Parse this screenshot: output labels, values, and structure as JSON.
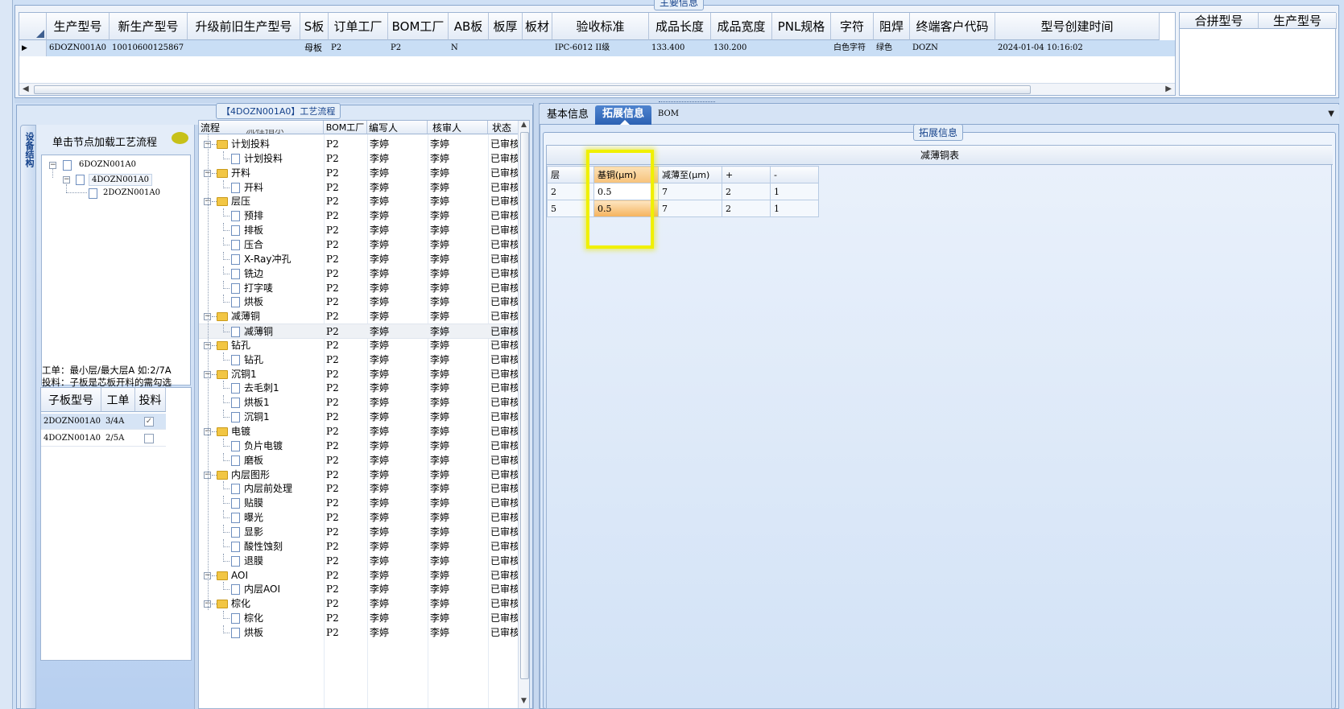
{
  "top_group_title": "主要信息",
  "main_grid": {
    "columns": [
      {
        "label": "生产型号"
      },
      {
        "label": "新生产型号"
      },
      {
        "label": "升级前旧生产型号"
      },
      {
        "label": "S板"
      },
      {
        "label": "订单工厂"
      },
      {
        "label": "BOM工厂"
      },
      {
        "label": "AB板"
      },
      {
        "label": "板厚"
      },
      {
        "label": "板材"
      },
      {
        "label": "验收标准"
      },
      {
        "label": "成品长度"
      },
      {
        "label": "成品宽度"
      },
      {
        "label": "PNL规格"
      },
      {
        "label": "字符"
      },
      {
        "label": "阻焊"
      },
      {
        "label": "终端客户代码"
      },
      {
        "label": "型号创建时间"
      }
    ],
    "row": [
      "6DOZN001A0",
      "10010600125867",
      "",
      "母板",
      "P2",
      "P2",
      "N",
      "",
      "",
      "IPC-6012 II级",
      "133.400",
      "130.200",
      "",
      "白色字符",
      "绿色",
      "DOZN",
      "2024-01-04 10:16:02"
    ]
  },
  "right_grid": {
    "columns": [
      "合拼型号",
      "生产型号"
    ]
  },
  "left_panel": {
    "side_tab": "设备结构",
    "hint": "单击节点加载工艺流程",
    "tree": [
      "6DOZN001A0",
      "4DOZN001A0",
      "2DOZN001A0"
    ],
    "note1": "工单：最小层/最大层A 如:2/7A",
    "note2": "投料：子板是芯板开料的需勾选",
    "sub_grid": {
      "columns": [
        "子板型号",
        "工单",
        "投料"
      ],
      "rows": [
        {
          "model": "2DOZN001A0",
          "order": "3/4A",
          "checked": true
        },
        {
          "model": "4DOZN001A0",
          "order": "2/5A",
          "checked": false
        }
      ]
    }
  },
  "process": {
    "title": "【4DOZN001A0】工艺流程",
    "columns": [
      "流程",
      "BOM工厂",
      "编写人",
      "核审人",
      "状态"
    ],
    "partial_top": "流程指示",
    "factory": "P2",
    "writer": "李婷",
    "reviewer": "李婷",
    "status": "已审核",
    "rows": [
      {
        "label": "计划投料",
        "folder": true
      },
      {
        "label": "计划投料",
        "folder": false
      },
      {
        "label": "开料",
        "folder": true
      },
      {
        "label": "开料",
        "folder": false
      },
      {
        "label": "层压",
        "folder": true
      },
      {
        "label": "预排",
        "folder": false
      },
      {
        "label": "排板",
        "folder": false
      },
      {
        "label": "压合",
        "folder": false
      },
      {
        "label": "X-Ray冲孔",
        "folder": false
      },
      {
        "label": "铣边",
        "folder": false
      },
      {
        "label": "打字唛",
        "folder": false
      },
      {
        "label": "烘板",
        "folder": false
      },
      {
        "label": "减薄铜",
        "folder": true
      },
      {
        "label": "减薄铜",
        "folder": false,
        "selected": true
      },
      {
        "label": "钻孔",
        "folder": true
      },
      {
        "label": "钻孔",
        "folder": false
      },
      {
        "label": "沉铜1",
        "folder": true
      },
      {
        "label": "去毛刺1",
        "folder": false
      },
      {
        "label": "烘板1",
        "folder": false
      },
      {
        "label": "沉铜1",
        "folder": false
      },
      {
        "label": "电镀",
        "folder": true
      },
      {
        "label": "负片电镀",
        "folder": false
      },
      {
        "label": "磨板",
        "folder": false
      },
      {
        "label": "内层图形",
        "folder": true
      },
      {
        "label": "内层前处理",
        "folder": false
      },
      {
        "label": "贴膜",
        "folder": false
      },
      {
        "label": "曝光",
        "folder": false
      },
      {
        "label": "显影",
        "folder": false
      },
      {
        "label": "酸性蚀刻",
        "folder": false
      },
      {
        "label": "退膜",
        "folder": false
      },
      {
        "label": "AOI",
        "folder": true
      },
      {
        "label": "内层AOI",
        "folder": false
      },
      {
        "label": "棕化",
        "folder": true
      },
      {
        "label": "棕化",
        "folder": false
      },
      {
        "label": "烘板",
        "folder": false
      }
    ]
  },
  "right_panel": {
    "tabs": [
      "基本信息",
      "拓展信息",
      "BOM"
    ],
    "active_tab": "拓展信息",
    "group_title": "拓展信息",
    "table_title": "减薄铜表",
    "columns": [
      "层",
      "基铜(μm)",
      "减薄至(μm)",
      "+",
      "-"
    ],
    "rows": [
      [
        "2",
        "0.5",
        "7",
        "2",
        "1"
      ],
      [
        "5",
        "0.5",
        "7",
        "2",
        "1"
      ]
    ],
    "highlight_color": "#f0f000"
  }
}
